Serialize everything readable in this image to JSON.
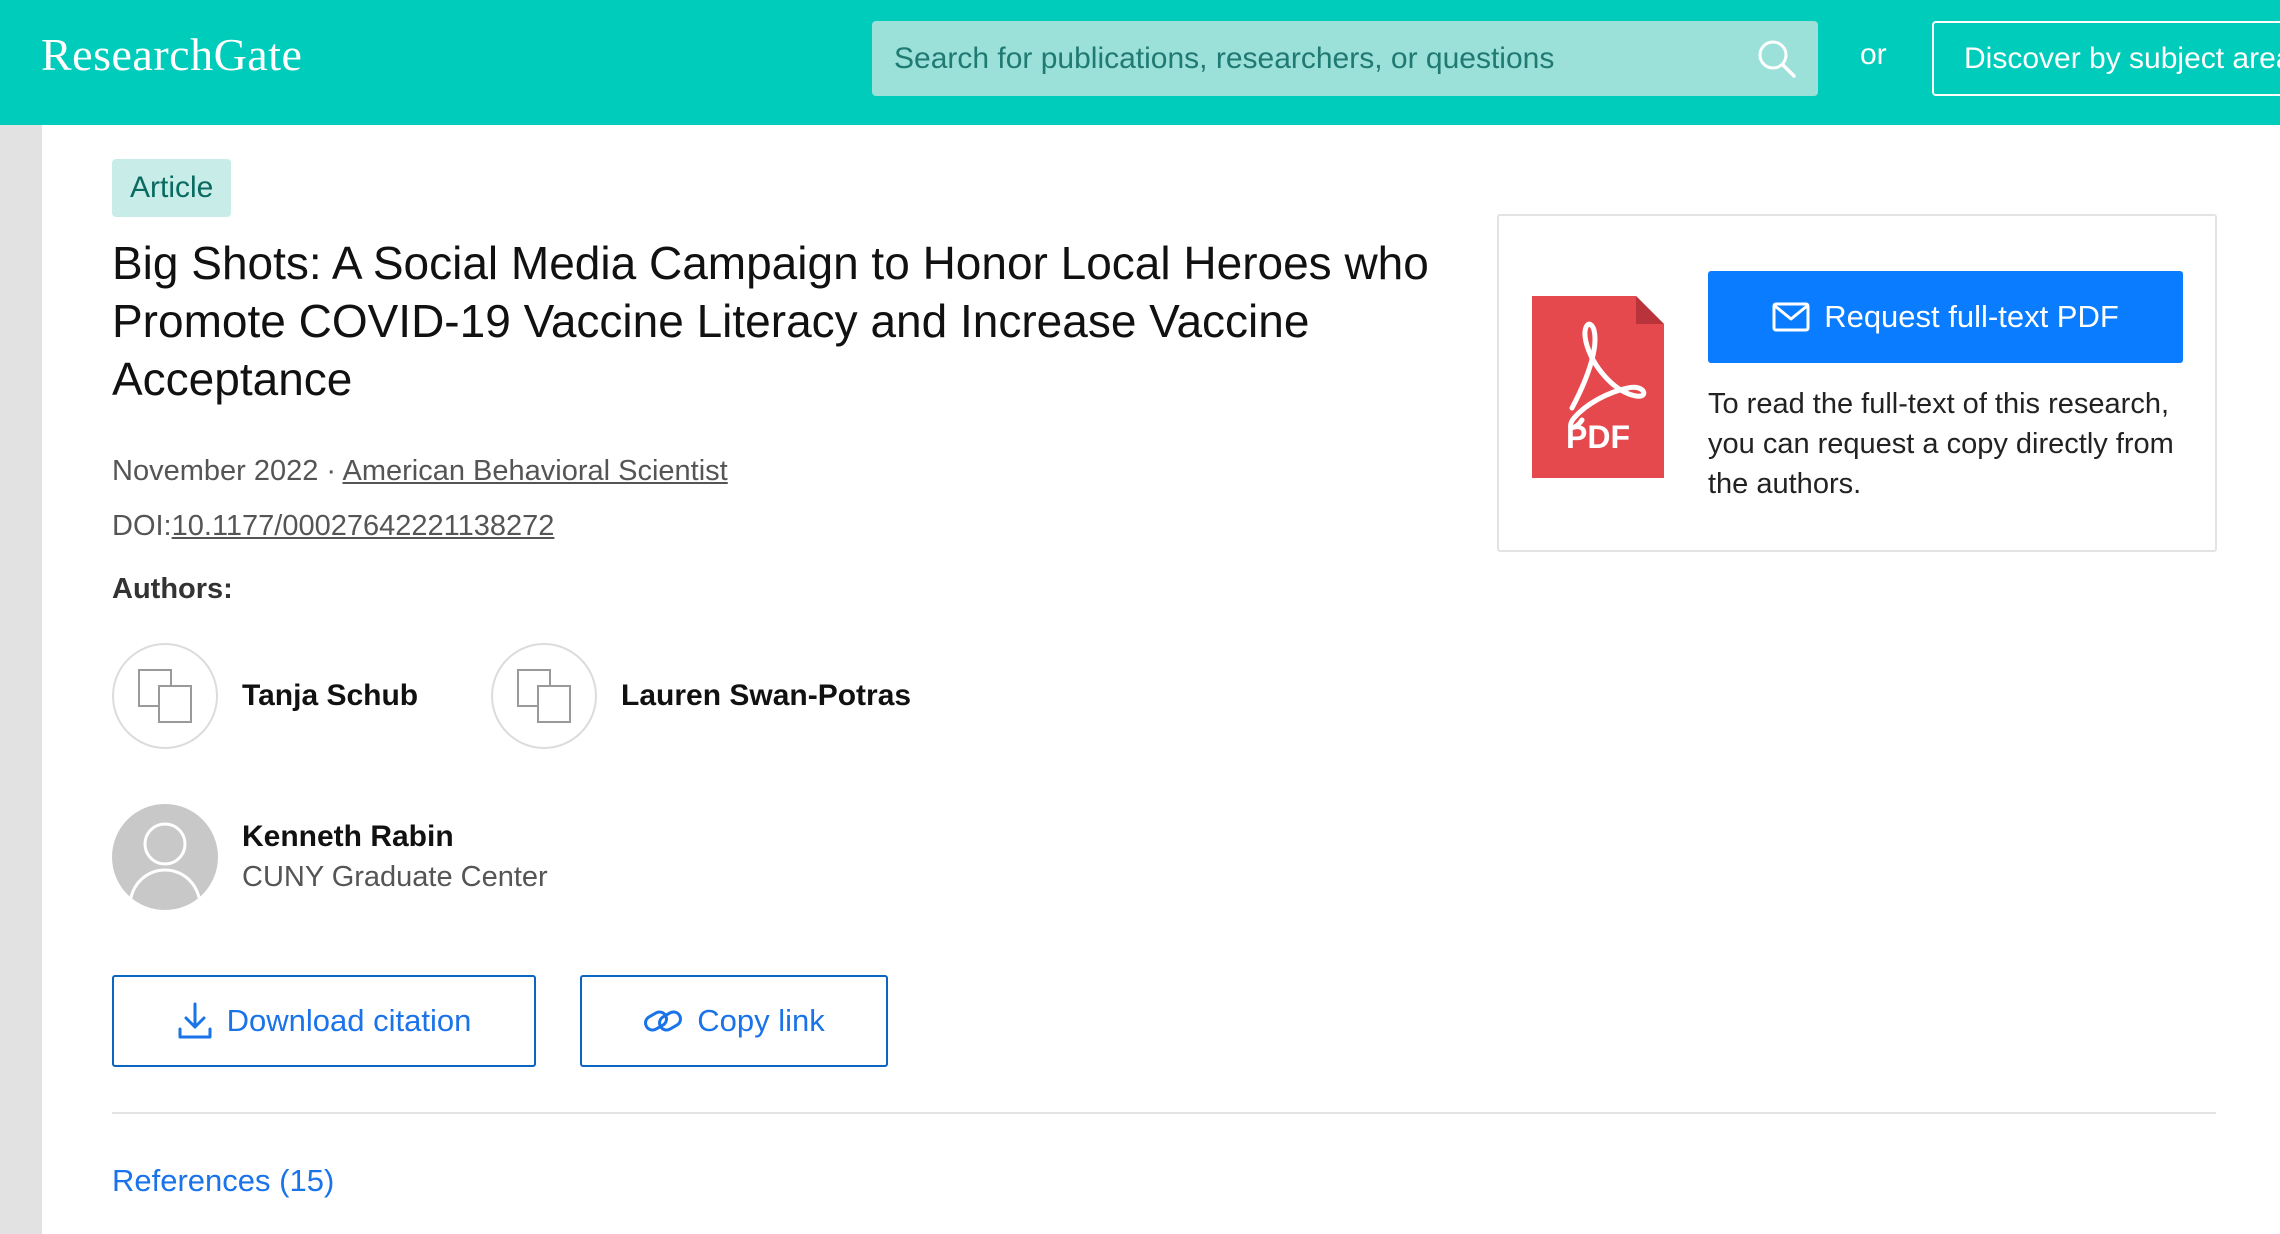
{
  "header": {
    "logo_text": "ResearchGate",
    "search_placeholder": "Search for publications, researchers, or questions",
    "or_label": "or",
    "discover_label": "Discover by subject area"
  },
  "article": {
    "type_badge": "Article",
    "title": "Big Shots: A Social Media Campaign to Honor Local Heroes who Promote COVID-19 Vaccine Literacy and Increase Vaccine Acceptance",
    "date": "November 2022",
    "separator": " · ",
    "journal": "American Behavioral Scientist",
    "doi_label": "DOI:",
    "doi": "10.1177/00027642221138272",
    "authors_heading": "Authors:",
    "authors": [
      {
        "name": "Tanja Schub",
        "affiliation": ""
      },
      {
        "name": "Lauren Swan-Potras",
        "affiliation": ""
      },
      {
        "name": "Kenneth Rabin",
        "affiliation": "CUNY Graduate Center"
      }
    ],
    "download_citation_label": "Download citation",
    "copy_link_label": "Copy link",
    "references_label": "References (15)"
  },
  "fulltext_card": {
    "pdf_icon_text": "PDF",
    "request_button_label": "Request full-text PDF",
    "description": "To read the full-text of this research, you can request a copy directly from the authors."
  },
  "colors": {
    "brand_teal": "#00ccbb",
    "search_bg": "#9be0d9",
    "primary_blue": "#0a7cff",
    "link_blue": "#1a73e8",
    "pdf_red": "#e5484d"
  }
}
